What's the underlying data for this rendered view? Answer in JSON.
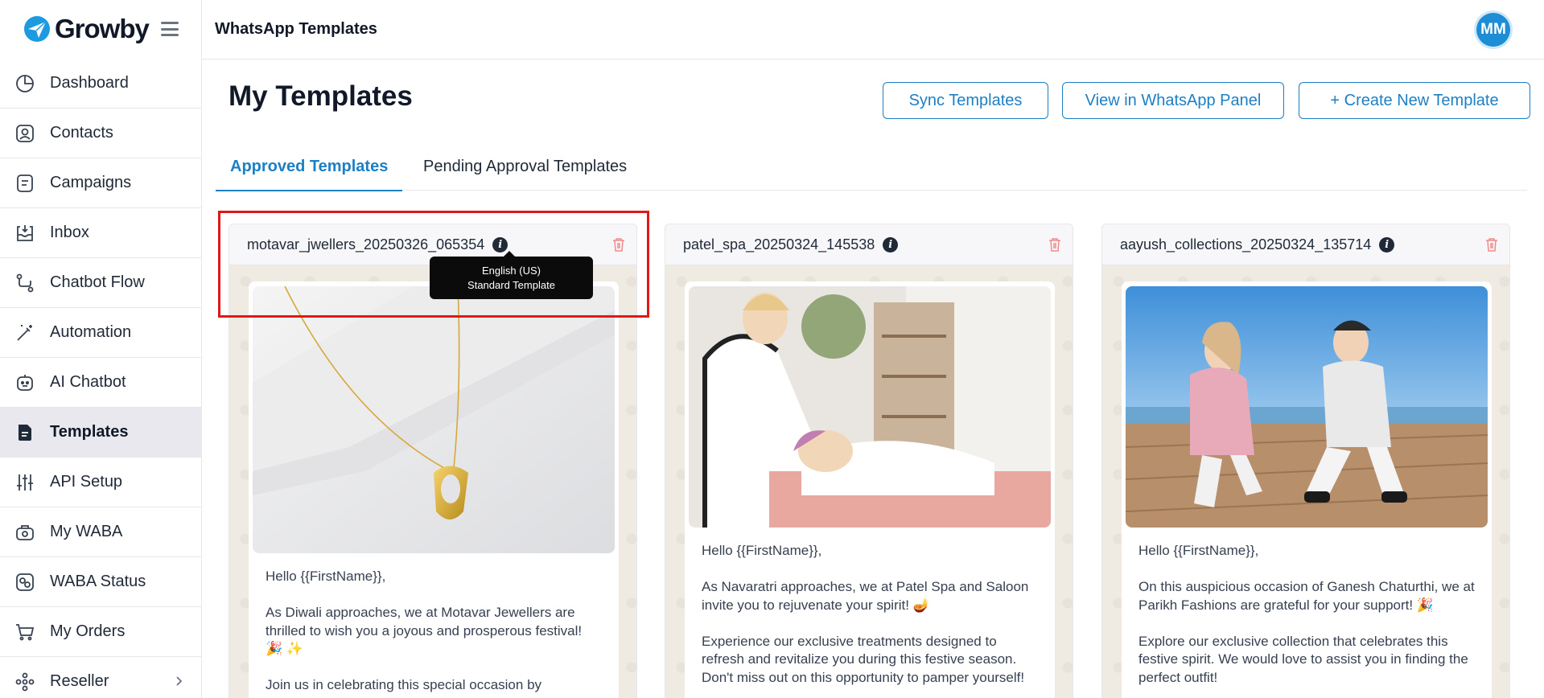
{
  "brand": {
    "name": "Growby"
  },
  "topbar": {
    "title": "WhatsApp Templates",
    "avatar_initials": "MM"
  },
  "sidebar": {
    "items": [
      {
        "label": "Dashboard",
        "icon": "pie-chart-icon"
      },
      {
        "label": "Contacts",
        "icon": "contact-card-icon"
      },
      {
        "label": "Campaigns",
        "icon": "document-icon"
      },
      {
        "label": "Inbox",
        "icon": "inbox-icon"
      },
      {
        "label": "Chatbot Flow",
        "icon": "flow-icon"
      },
      {
        "label": "Automation",
        "icon": "magic-wand-icon"
      },
      {
        "label": "AI Chatbot",
        "icon": "robot-icon"
      },
      {
        "label": "Templates",
        "icon": "template-icon",
        "active": true
      },
      {
        "label": "API Setup",
        "icon": "sliders-icon"
      },
      {
        "label": "My WABA",
        "icon": "waba-icon"
      },
      {
        "label": "WABA Status",
        "icon": "status-icon"
      },
      {
        "label": "My Orders",
        "icon": "cart-icon"
      },
      {
        "label": "Reseller",
        "icon": "network-icon",
        "has_submenu": true
      }
    ]
  },
  "main": {
    "title": "My Templates",
    "buttons": {
      "sync": "Sync Templates",
      "view": "View in WhatsApp Panel",
      "create": "+ Create New Template"
    },
    "tabs": {
      "approved": "Approved Templates",
      "pending": "Pending Approval Templates"
    }
  },
  "tooltip": {
    "line1": "English (US)",
    "line2": "Standard Template"
  },
  "templates": [
    {
      "name": "motavar_jwellers_20250326_065354",
      "body": "Hello {{FirstName}},\n\nAs Diwali approaches, we at Motavar Jewellers are thrilled to wish you a joyous and prosperous festival! 🎉 ✨\n\nJoin us in celebrating this special occasion by"
    },
    {
      "name": "patel_spa_20250324_145538",
      "body": "Hello {{FirstName}},\n\nAs Navaratri approaches, we at Patel Spa and Saloon invite you to rejuvenate your spirit! 🪔\n\nExperience our exclusive treatments designed to refresh and revitalize you during this festive season. Don't miss out on this opportunity to pamper yourself!"
    },
    {
      "name": "aayush_collections_20250324_135714",
      "body": "Hello {{FirstName}},\n\nOn this auspicious occasion of Ganesh Chaturthi, we at Parikh Fashions are grateful for your support! 🎉\n\nExplore our exclusive collection that celebrates this festive spirit. We would love to assist you in finding the perfect outfit!"
    }
  ],
  "colors": {
    "accent": "#1d7fc4",
    "highlight": "#e01818",
    "avatar": "#1d8ed6"
  }
}
